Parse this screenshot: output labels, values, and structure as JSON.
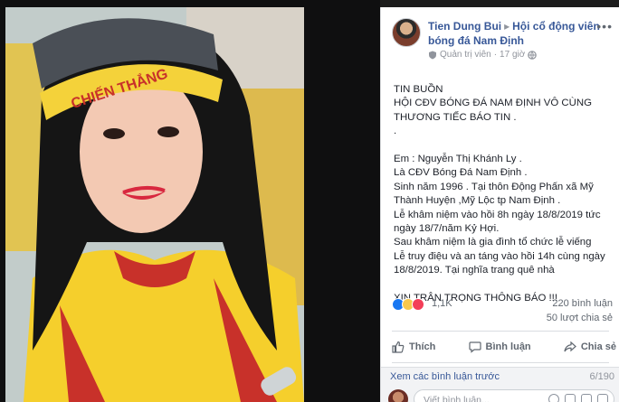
{
  "post": {
    "author": "Tien Dung Bui",
    "group": "Hội cổ động viên bóng đá Nam Định",
    "role": "Quản trị viên",
    "time": "17 giờ",
    "lines": [
      "TIN BUỒN",
      "HỘI CĐV BÓNG ĐÁ NAM ĐỊNH VÔ CÙNG THƯƠNG TIẾC BÁO TIN .",
      ".",
      "",
      "Em : Nguyễn Thị Khánh Ly .",
      "Là CĐV Bóng Đá Nam Định .",
      "Sinh năm 1996 . Tại thôn Động Phấn xã Mỹ Thành Huyện ,Mỹ Lộc tp Nam Định .",
      "Lễ khâm niệm vào hồi 8h ngày 18/8/2019 tức ngày 18/7/năm Kỷ Hợi.",
      "Sau khâm niệm là gia đình tổ chức lễ viếng",
      "Lễ truy điệu và an táng vào hồi 14h cùng ngày 18/8/2019. Tại nghĩa trang quê nhà",
      "",
      "XIN TRÂN TRỌNG THÔNG BÁO !!!"
    ]
  },
  "stats": {
    "reactions": "1,1K",
    "comments": "220 bình luận",
    "shares": "50 lượt chia sẻ"
  },
  "actions": {
    "like": "Thích",
    "comment": "Bình luận",
    "share": "Chia sẻ"
  },
  "comments": {
    "view_more": "Xem các bình luận trước",
    "pager": "6/190",
    "placeholder": "Viết bình luận..."
  },
  "photo": {
    "headband_text": "CHIẾN THẮNG"
  }
}
